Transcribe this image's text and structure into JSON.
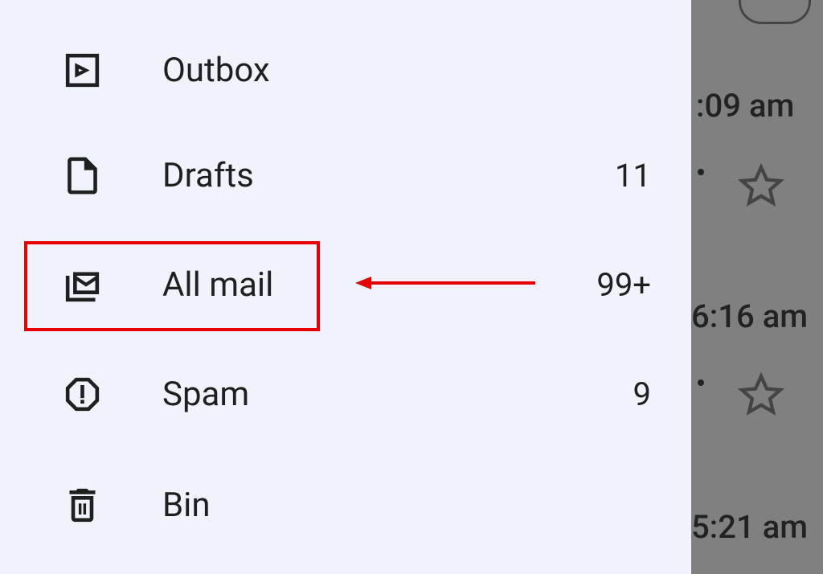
{
  "sidebar": {
    "items": [
      {
        "label": "Outbox",
        "count": ""
      },
      {
        "label": "Drafts",
        "count": "11"
      },
      {
        "label": "All mail",
        "count": "99+"
      },
      {
        "label": "Spam",
        "count": "9"
      },
      {
        "label": "Bin",
        "count": ""
      }
    ]
  },
  "background": {
    "times": [
      ":09 am",
      "6:16 am",
      "5:21 am"
    ]
  },
  "annotation": {
    "highlighted_item": "All mail"
  }
}
